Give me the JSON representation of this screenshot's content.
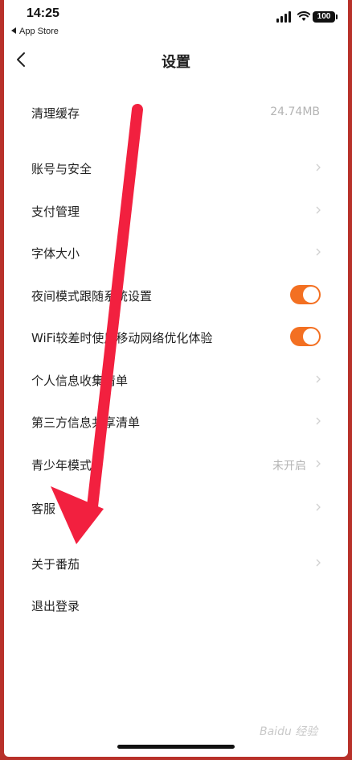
{
  "status_bar": {
    "time": "14:25",
    "back_app": "App Store",
    "battery": "100"
  },
  "nav": {
    "title": "设置"
  },
  "settings": {
    "clear_cache": {
      "label": "清理缓存",
      "value": "24.74MB"
    },
    "account_security": {
      "label": "账号与安全"
    },
    "payment": {
      "label": "支付管理"
    },
    "font_size": {
      "label": "字体大小"
    },
    "night_mode": {
      "label": "夜间模式跟随系统设置",
      "enabled": true
    },
    "wifi_opt": {
      "label": "WiFi较差时使用移动网络优化体验",
      "enabled": true
    },
    "personal_info": {
      "label": "个人信息收集清单"
    },
    "third_party": {
      "label": "第三方信息共享清单"
    },
    "teen_mode": {
      "label": "青少年模式",
      "value": "未开启"
    },
    "customer_service": {
      "label": "客服"
    },
    "about": {
      "label": "关于番茄"
    },
    "logout": {
      "label": "退出登录"
    }
  },
  "colors": {
    "toggle_on": "#f37022",
    "annotation_arrow": "#f2203f"
  },
  "watermark": "Baidu 经验"
}
